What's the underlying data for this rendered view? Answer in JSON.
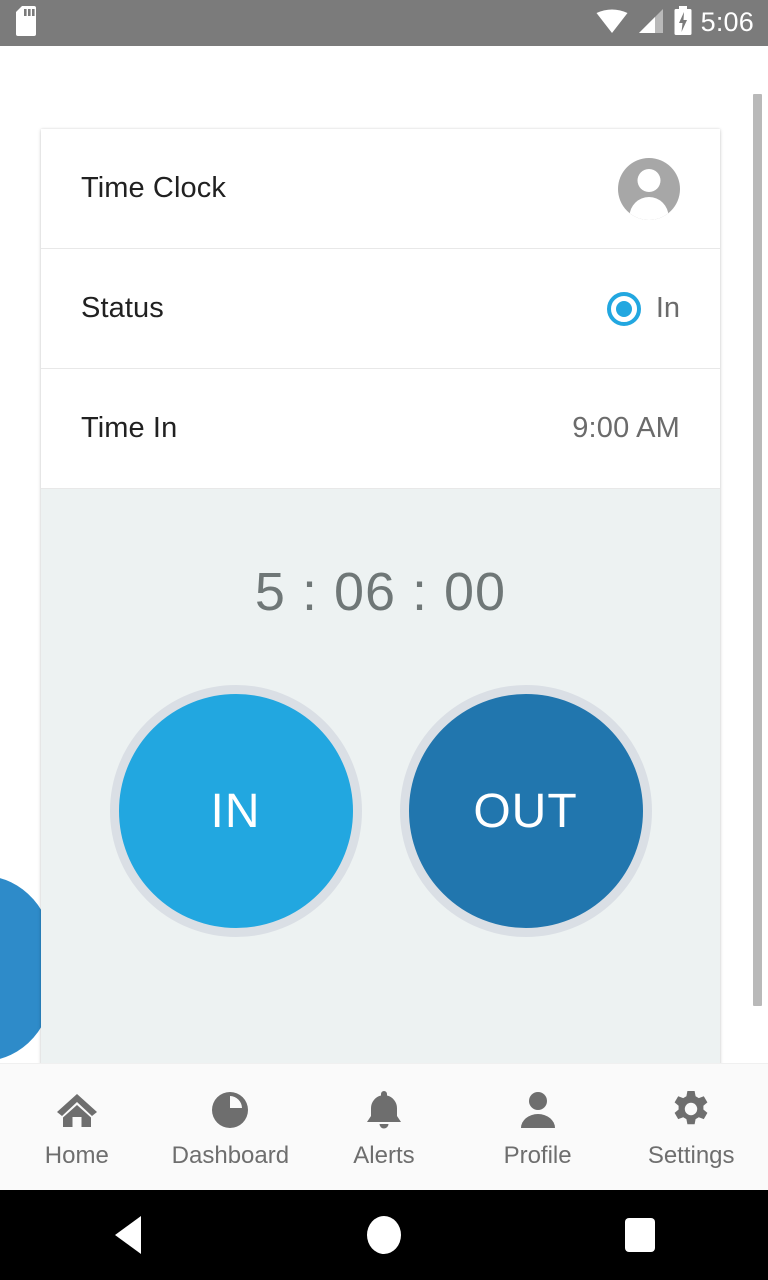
{
  "status_bar": {
    "time": "5:06",
    "icons": [
      "sd-card-icon",
      "wifi-icon",
      "cellular-signal-icon",
      "battery-charging-icon"
    ]
  },
  "card": {
    "title": "Time Clock",
    "avatar_icon": "user-avatar-icon",
    "rows": [
      {
        "label": "Status",
        "value": "In",
        "control": "radio-selected"
      },
      {
        "label": "Time In",
        "value": "9:00 AM",
        "control": "text"
      }
    ]
  },
  "clock": {
    "timer": "5 : 06 : 00",
    "hours": "5",
    "minutes": "06",
    "seconds": "00",
    "in_button": "IN",
    "out_button": "OUT"
  },
  "colors": {
    "accent_light_blue": "#22a7e0",
    "accent_dark_blue": "#2176ae",
    "panel_bg": "#edf2f2",
    "button_ring": "#dadfe5",
    "status_bar_bg": "#7b7b7b",
    "nav_icon_gray": "#6e6e6e"
  },
  "bottom_nav": {
    "items": [
      {
        "label": "Home",
        "icon": "home-icon"
      },
      {
        "label": "Dashboard",
        "icon": "pie-chart-icon"
      },
      {
        "label": "Alerts",
        "icon": "bell-icon"
      },
      {
        "label": "Profile",
        "icon": "person-icon"
      },
      {
        "label": "Settings",
        "icon": "gear-icon"
      }
    ]
  },
  "android_nav": {
    "back": "back-icon",
    "home": "home-circle-icon",
    "recents": "recents-square-icon"
  }
}
